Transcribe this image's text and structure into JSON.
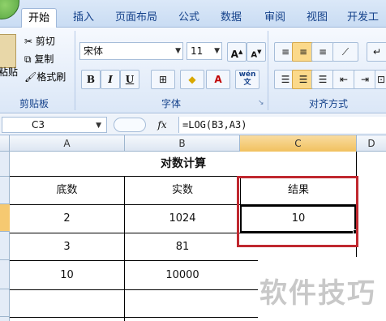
{
  "ribbon": {
    "tabs": [
      "开始",
      "插入",
      "页面布局",
      "公式",
      "数据",
      "审阅",
      "视图",
      "开发工"
    ],
    "clipboard": {
      "paste": "粘贴",
      "cut": "剪切",
      "copy": "复制",
      "format_painter": "格式刷",
      "label": "剪贴板"
    },
    "font": {
      "name": "宋体",
      "size": "11",
      "bold": "B",
      "italic": "I",
      "underline": "U",
      "label": "字体",
      "wen": "wén"
    },
    "alignment": {
      "label": "对齐方式"
    }
  },
  "formula_bar": {
    "name_box": "C3",
    "fx": "fx",
    "formula": "=LOG(B3,A3)"
  },
  "sheet": {
    "columns": [
      "A",
      "B",
      "C",
      "D"
    ],
    "title": "对数计算",
    "headers": [
      "底数",
      "实数",
      "结果"
    ],
    "rows": [
      {
        "a": "2",
        "b": "1024",
        "c": "10"
      },
      {
        "a": "3",
        "b": "81",
        "c": ""
      },
      {
        "a": "10",
        "b": "10000",
        "c": ""
      }
    ]
  },
  "watermark": "软件技巧",
  "colors": {
    "ribbon_blue": "#dbe8f8",
    "selection_red": "#c0282f",
    "header_orange": "#f1c15f"
  }
}
